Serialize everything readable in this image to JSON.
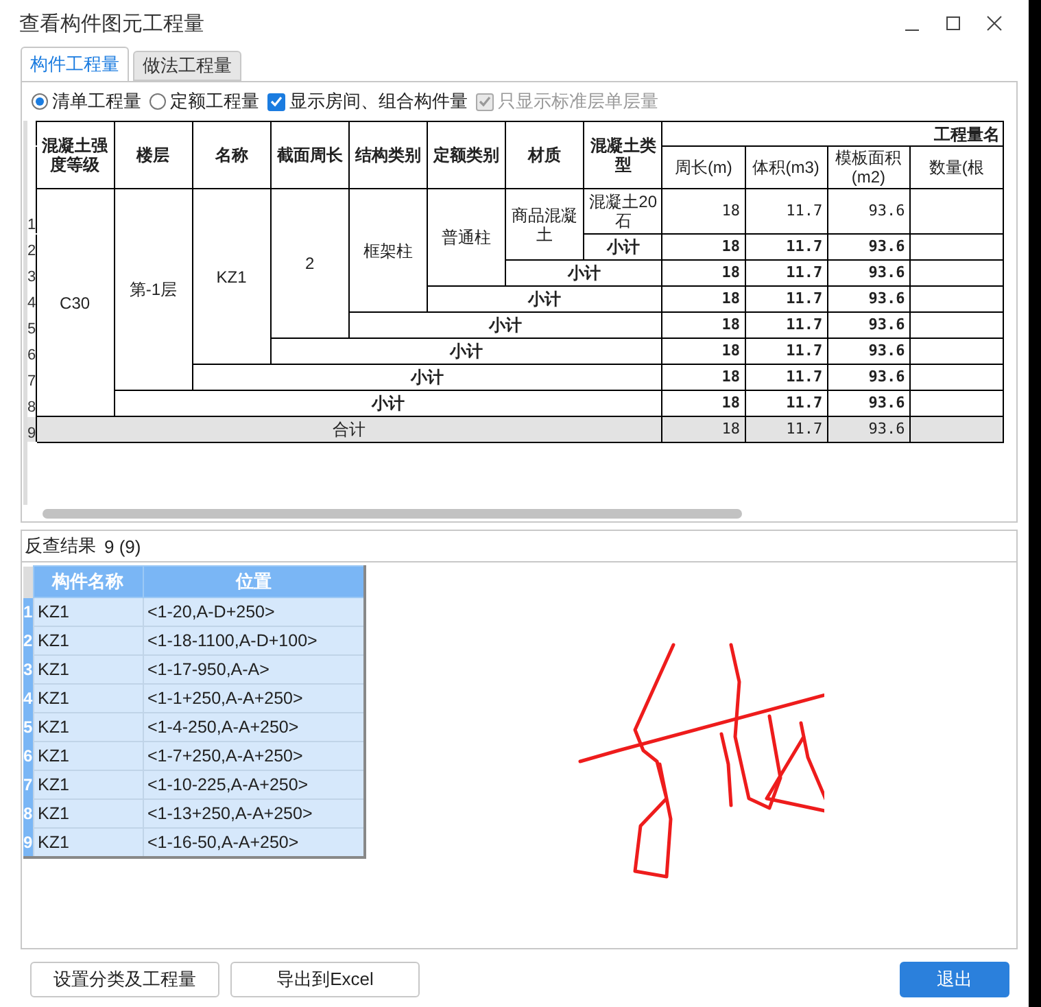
{
  "window": {
    "title": "查看构件图元工程量"
  },
  "tabs": [
    {
      "label": "构件工程量",
      "selected": true
    },
    {
      "label": "做法工程量",
      "selected": false
    }
  ],
  "options": [
    {
      "kind": "radio",
      "label": "清单工程量",
      "checked": true,
      "disabled": false
    },
    {
      "kind": "radio",
      "label": "定额工程量",
      "checked": false,
      "disabled": false
    },
    {
      "kind": "checkbox",
      "label": "显示房间、组合构件量",
      "checked": true,
      "disabled": false
    },
    {
      "kind": "checkbox",
      "label": "只显示标准层单层量",
      "checked": true,
      "disabled": true
    }
  ],
  "quantity_table": {
    "group_header": "工程量名",
    "columns": [
      "混凝土强度等级",
      "楼层",
      "名称",
      "截面周长",
      "结构类别",
      "定额类别",
      "材质",
      "混凝土类型",
      "周长(m)",
      "体积(m3)",
      "模板面积(m2)",
      "数量(根"
    ],
    "rows": [
      {
        "number": "1",
        "kind": "detail",
        "cells": [
          {
            "text": "C30",
            "rowspan": 8
          },
          {
            "text": "第-1层",
            "rowspan": 7
          },
          {
            "text": "KZ1",
            "rowspan": 6
          },
          {
            "text": "2",
            "rowspan": 5
          },
          {
            "text": "框架柱",
            "rowspan": 4
          },
          {
            "text": "普通柱",
            "rowspan": 3
          },
          {
            "text": "商品混凝土",
            "rowspan": 2
          },
          {
            "text": "混凝土20石"
          }
        ],
        "values": [
          "18",
          "11.7",
          "93.6"
        ]
      },
      {
        "number": "2",
        "kind": "subtotal",
        "cells": [
          {
            "text": "小计"
          }
        ],
        "values": [
          "18",
          "11.7",
          "93.6"
        ]
      },
      {
        "number": "3",
        "kind": "subtotal",
        "cells": [
          {
            "text": "小计",
            "colspan": 2
          }
        ],
        "values": [
          "18",
          "11.7",
          "93.6"
        ]
      },
      {
        "number": "4",
        "kind": "subtotal",
        "cells": [
          {
            "text": "小计",
            "colspan": 3
          }
        ],
        "values": [
          "18",
          "11.7",
          "93.6"
        ]
      },
      {
        "number": "5",
        "kind": "subtotal",
        "cells": [
          {
            "text": "小计",
            "colspan": 4
          }
        ],
        "values": [
          "18",
          "11.7",
          "93.6"
        ]
      },
      {
        "number": "6",
        "kind": "subtotal",
        "cells": [
          {
            "text": "小计",
            "colspan": 5
          }
        ],
        "values": [
          "18",
          "11.7",
          "93.6"
        ]
      },
      {
        "number": "7",
        "kind": "subtotal",
        "cells": [
          {
            "text": "小计",
            "colspan": 6
          }
        ],
        "values": [
          "18",
          "11.7",
          "93.6"
        ]
      },
      {
        "number": "8",
        "kind": "subtotal",
        "cells": [
          {
            "text": "小计",
            "colspan": 7
          }
        ],
        "values": [
          "18",
          "11.7",
          "93.6"
        ]
      },
      {
        "number": "9",
        "kind": "total",
        "cells": [
          {
            "text": "合计",
            "colspan": 8
          }
        ],
        "values": [
          "18",
          "11.7",
          "93.6"
        ]
      }
    ]
  },
  "results": {
    "title": "反查结果",
    "count": "9 (9)",
    "columns": [
      "构件名称",
      "位置"
    ],
    "rows": [
      {
        "number": "1",
        "name": "KZ1",
        "position": "<1-20,A-D+250>"
      },
      {
        "number": "2",
        "name": "KZ1",
        "position": "<1-18-1100,A-D+100>"
      },
      {
        "number": "3",
        "name": "KZ1",
        "position": "<1-17-950,A-A>"
      },
      {
        "number": "4",
        "name": "KZ1",
        "position": "<1-1+250,A-A+250>"
      },
      {
        "number": "5",
        "name": "KZ1",
        "position": "<1-4-250,A-A+250>"
      },
      {
        "number": "6",
        "name": "KZ1",
        "position": "<1-7+250,A-A+250>"
      },
      {
        "number": "7",
        "name": "KZ1",
        "position": "<1-10-225,A-A+250>"
      },
      {
        "number": "8",
        "name": "KZ1",
        "position": "<1-13+250,A-A+250>"
      },
      {
        "number": "9",
        "name": "KZ1",
        "position": "<1-16-50,A-A+250>"
      }
    ]
  },
  "buttons": [
    {
      "label": "设置分类及工程量",
      "kind": "normal"
    },
    {
      "label": "导出到Excel",
      "kind": "normal"
    },
    {
      "label": "退出",
      "kind": "primary"
    }
  ]
}
